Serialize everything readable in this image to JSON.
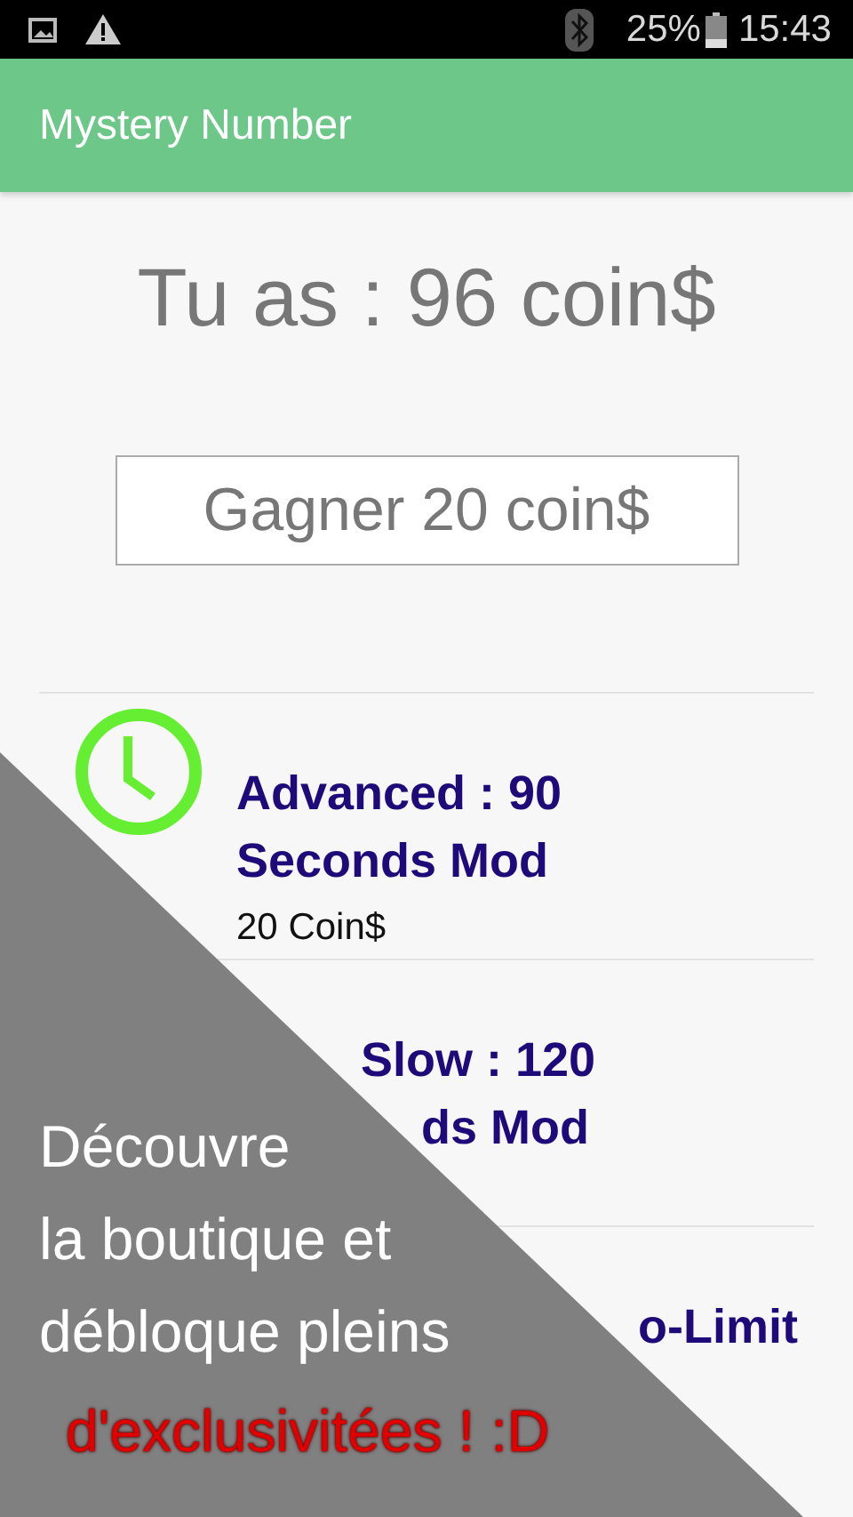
{
  "status_bar": {
    "battery": "25%",
    "time": "15:43"
  },
  "app_bar": {
    "title": "Mystery Number"
  },
  "balance": "Tu as : 96 coin$",
  "earn_button": "Gagner 20 coin$",
  "shop_items": [
    {
      "kind": "clock",
      "title_lines": [
        "Advanced : 90",
        "Seconds Mod"
      ],
      "price": "20 Coin$"
    },
    {
      "kind": "hidden",
      "title_lines": [
        "Slow : 120",
        "ds Mod"
      ]
    },
    {
      "kind": "hidden",
      "title_lines": [
        "o-Limit"
      ]
    }
  ],
  "promo": {
    "lines": [
      "Découvre",
      "la boutique et",
      "débloque pleins"
    ],
    "highlight": "d'exclusivitées ! :D"
  }
}
